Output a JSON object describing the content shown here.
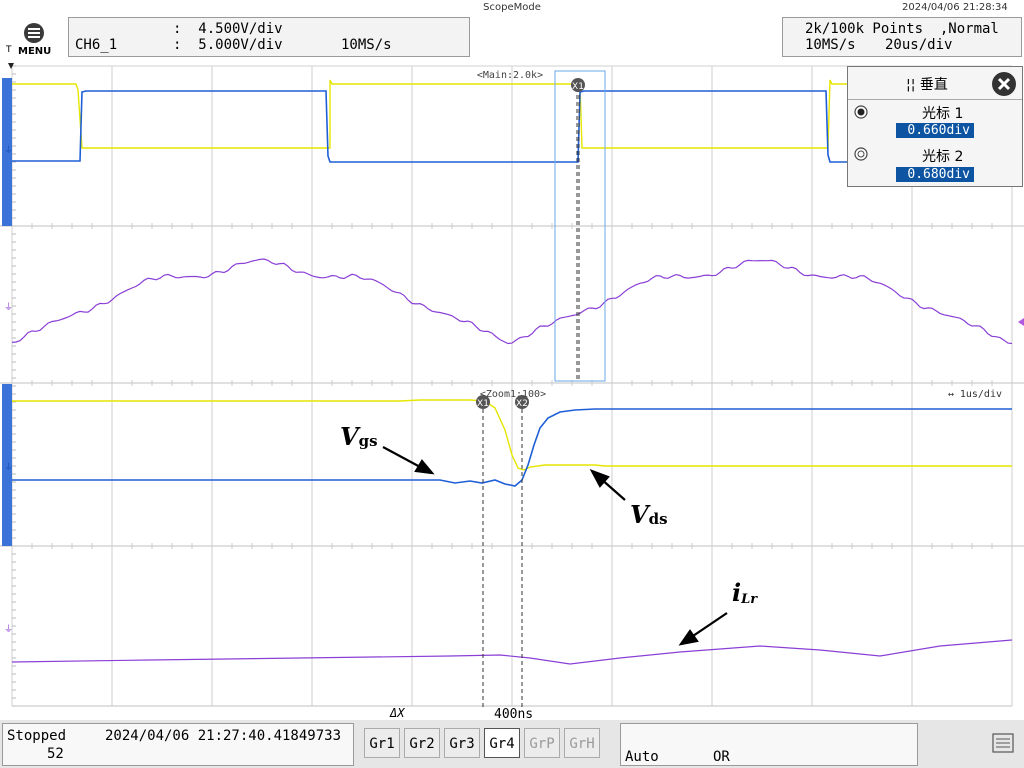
{
  "header": {
    "title": "ScopeMode",
    "datetime": "2024/04/06 21:28:34",
    "menu_label": "MENU",
    "menu_icon": "menu-icon",
    "trigger_mark": "T",
    "channel_label": "CH6_1",
    "scale1": ":  4.500V/div",
    "scale2": ":  5.000V/div",
    "rate": "10MS/s",
    "points": "2k/100k Points  ,Normal",
    "sample_rate": "10MS/s",
    "time_div": "20us/div"
  },
  "plot": {
    "main_label": "<Main:2.0k>",
    "zoom_label": "<Zoom1:100>",
    "zoom_timediv": "↔ 1us/div",
    "x1_marker": "X1",
    "x2_marker": "X2"
  },
  "cursor_panel": {
    "title": "¦¦ 垂直",
    "cursor1_label": "光标 1",
    "cursor1_value": "0.660div",
    "cursor2_label": "光标 2",
    "cursor2_value": "0.680div",
    "close_icon": "close-icon"
  },
  "annotations": {
    "vgs_main": "V",
    "vgs_sub": "gs",
    "vds_main": "V",
    "vds_sub": "ds",
    "ilr_main": "i",
    "ilr_sub": "Lr"
  },
  "delta": {
    "label": "ΔX",
    "value": "400ns"
  },
  "status": {
    "state": "Stopped",
    "count": "52",
    "timestamp": "2024/04/06 21:27:40.41849733"
  },
  "groups": [
    "Gr1",
    "Gr2",
    "Gr3",
    "Gr4",
    "GrP",
    "GrH"
  ],
  "group_selected": "Gr4",
  "trigger": {
    "mode": "Auto",
    "logic": "OR"
  },
  "colors": {
    "yellow": "#e6e600",
    "blue": "#1f5fd6",
    "purple": "#8a3fd6",
    "grid": "#c8c8c8",
    "cursor_box": "#6aa8e8",
    "accent": "#0d55a2"
  }
}
